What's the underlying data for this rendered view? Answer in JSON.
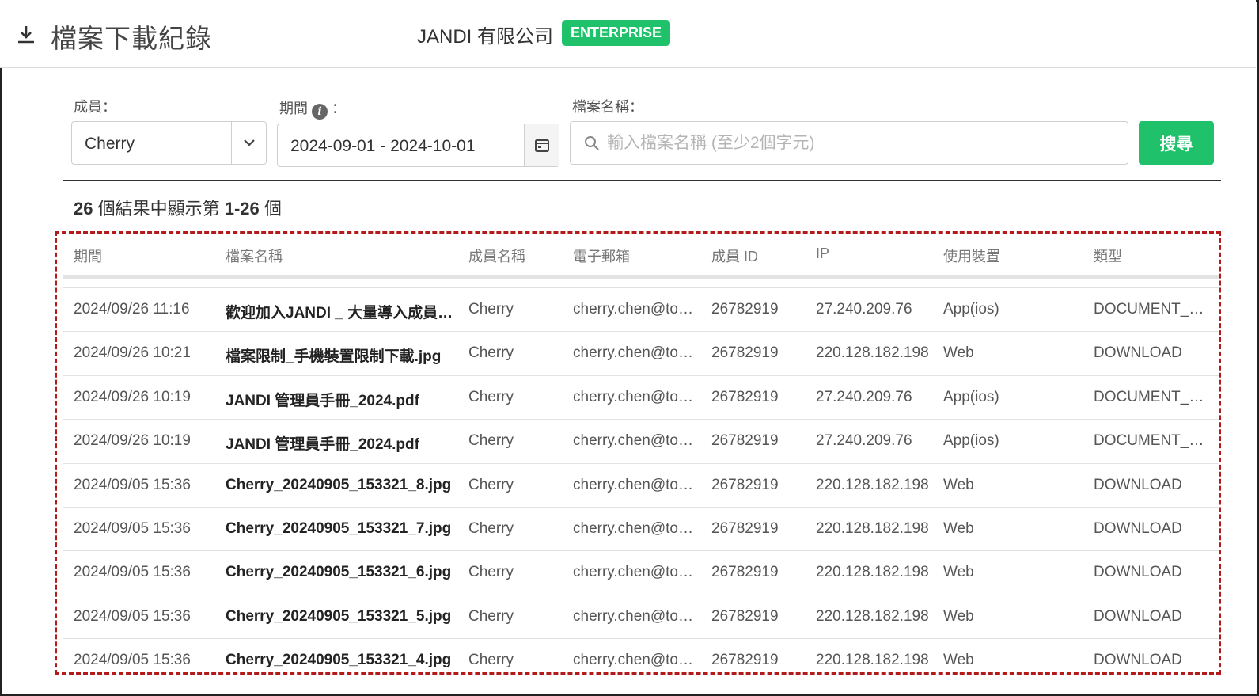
{
  "header": {
    "title": "檔案下載紀錄",
    "company": "JANDI 有限公司",
    "badge": "ENTERPRISE"
  },
  "filters": {
    "member_label": "成員：",
    "member_value": "Cherry",
    "period_label": "期間",
    "period_colon": "：",
    "period_value": "2024-09-01 - 2024-10-01",
    "filename_label": "檔案名稱：",
    "filename_placeholder": "輸入檔案名稱 (至少2個字元)",
    "search_button": "搜尋"
  },
  "result": {
    "total": "26",
    "prefix": " 個結果中顯示第 ",
    "range": "1-26",
    "suffix": " 個"
  },
  "table": {
    "headers": [
      "期間",
      "檔案名稱",
      "成員名稱",
      "電子郵箱",
      "成員 ID",
      "IP",
      "使用裝置",
      "類型"
    ],
    "rows": [
      [
        "2024/09/26 11:16",
        "歡迎加入JANDI _ 大量導入成員.pdf",
        "Cherry",
        "cherry.chen@toss.com",
        "26782919",
        "27.240.209.76",
        "App(ios)",
        "DOCUMENT_PREVIEW"
      ],
      [
        "2024/09/26 10:21",
        "檔案限制_手機裝置限制下載.jpg",
        "Cherry",
        "cherry.chen@toss.com",
        "26782919",
        "220.128.182.198",
        "Web",
        "DOWNLOAD"
      ],
      [
        "2024/09/26 10:19",
        "JANDI 管理員手冊_2024.pdf",
        "Cherry",
        "cherry.chen@toss.com",
        "26782919",
        "27.240.209.76",
        "App(ios)",
        "DOCUMENT_PREVIEW"
      ],
      [
        "2024/09/26 10:19",
        "JANDI 管理員手冊_2024.pdf",
        "Cherry",
        "cherry.chen@toss.com",
        "26782919",
        "27.240.209.76",
        "App(ios)",
        "DOCUMENT_PREVIEW"
      ],
      [
        "2024/09/05 15:36",
        "Cherry_20240905_153321_8.jpg",
        "Cherry",
        "cherry.chen@toss.com",
        "26782919",
        "220.128.182.198",
        "Web",
        "DOWNLOAD"
      ],
      [
        "2024/09/05 15:36",
        "Cherry_20240905_153321_7.jpg",
        "Cherry",
        "cherry.chen@toss.com",
        "26782919",
        "220.128.182.198",
        "Web",
        "DOWNLOAD"
      ],
      [
        "2024/09/05 15:36",
        "Cherry_20240905_153321_6.jpg",
        "Cherry",
        "cherry.chen@toss.com",
        "26782919",
        "220.128.182.198",
        "Web",
        "DOWNLOAD"
      ],
      [
        "2024/09/05 15:36",
        "Cherry_20240905_153321_5.jpg",
        "Cherry",
        "cherry.chen@toss.com",
        "26782919",
        "220.128.182.198",
        "Web",
        "DOWNLOAD"
      ],
      [
        "2024/09/05 15:36",
        "Cherry_20240905_153321_4.jpg",
        "Cherry",
        "cherry.chen@toss.com",
        "26782919",
        "220.128.182.198",
        "Web",
        "DOWNLOAD"
      ]
    ]
  },
  "colors": {
    "accent_green": "#1fc16b",
    "highlight_dash": "#b31b1b"
  },
  "icons": {
    "header": "download-icon",
    "member_select": "chevron-down-icon",
    "period_info": "info-icon",
    "period_picker": "calendar-icon",
    "filename_input": "search-icon"
  }
}
